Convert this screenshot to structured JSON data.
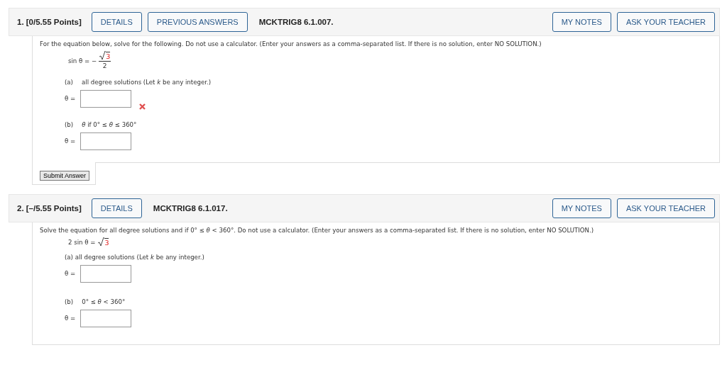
{
  "questions": [
    {
      "number": "1.",
      "points": "[0/5.55 Points]",
      "buttons": [
        "DETAILS",
        "PREVIOUS ANSWERS"
      ],
      "code": "MCKTRIG8 6.1.007.",
      "side_buttons": [
        "MY NOTES",
        "ASK YOUR TEACHER"
      ],
      "instructions": "For the equation below, solve for the following. Do not use a calculator. (Enter your answers as a comma-separated list. If there is no solution, enter NO SOLUTION.)",
      "equation": {
        "kind": "fraction",
        "lhs": "sin θ = −",
        "radicand": "3",
        "denominator": "2"
      },
      "parts": [
        {
          "label": "(a)",
          "text": "all degree solutions (Let *k* be any integer.)",
          "field_label": "θ =",
          "incorrect": true
        },
        {
          "label": "(b)",
          "text": "*θ* if 0° ≤ *θ* ≤ 360°",
          "field_label": "θ =",
          "incorrect": false
        }
      ],
      "submit": "Submit Answer"
    },
    {
      "number": "2.",
      "points": "[–/5.55 Points]",
      "buttons": [
        "DETAILS"
      ],
      "code": "MCKTRIG8 6.1.017.",
      "side_buttons": [
        "MY NOTES",
        "ASK YOUR TEACHER"
      ],
      "instructions": "Solve the equation for all degree solutions and if  0° ≤ *θ* < 360°.  Do not use a calculator. (Enter your answers as a comma-separated list. If there is no solution, enter NO SOLUTION.)",
      "equation": {
        "kind": "sqrt",
        "lhs": "2 sin θ =",
        "radicand": "3"
      },
      "parts": [
        {
          "text": "(a) all degree solutions (Let *k* be any integer.)",
          "field_label": "θ =",
          "incorrect": false
        },
        {
          "label": "(b)",
          "text": "0° ≤ *θ* < 360°",
          "field_label": "θ =",
          "incorrect": false
        }
      ]
    }
  ]
}
